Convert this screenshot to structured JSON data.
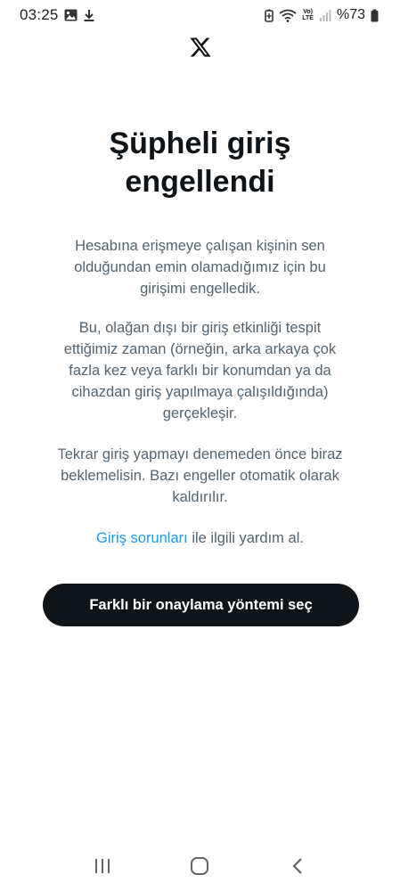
{
  "status_bar": {
    "time": "03:25",
    "battery": "%73",
    "volte_line1": "Vo)",
    "volte_line2": "LTE",
    "icons": [
      "gallery-icon",
      "download-icon",
      "battery-saver-icon",
      "wifi-icon",
      "volte-icon",
      "signal-icon",
      "battery-icon"
    ]
  },
  "logo": "x-logo-icon",
  "title": "Şüpheli giriş\nengellendi",
  "paragraphs": {
    "p1": "Hesabına erişmeye çalışan kişinin sen\nolduğundan emin olamadığımız için bu\ngirişimi engelledik.",
    "p2": "Bu, olağan dışı bir giriş etkinliği tespit\nettiğimiz zaman (örneğin, arka arkaya çok\nfazla kez veya farklı bir konumdan ya da\ncihazdan giriş yapılmaya çalışıldığında)\ngerçekleşir.",
    "p3": "Tekrar giriş yapmayı denemeden önce biraz\nbeklemelisin. Bazı engeller otomatik olarak\nkaldırılır."
  },
  "help": {
    "link_text": "Giriş sorunları",
    "suffix": " ile ilgili yardım al."
  },
  "cta_label": "Farklı bir onaylama yöntemi seç",
  "nav_bar": [
    "recent-apps-icon",
    "home-icon",
    "back-icon"
  ],
  "colors": {
    "text_primary": "#0f1419",
    "text_secondary": "#536471",
    "link": "#1d9bf0",
    "button_bg": "#0f1419",
    "button_text": "#ffffff"
  }
}
